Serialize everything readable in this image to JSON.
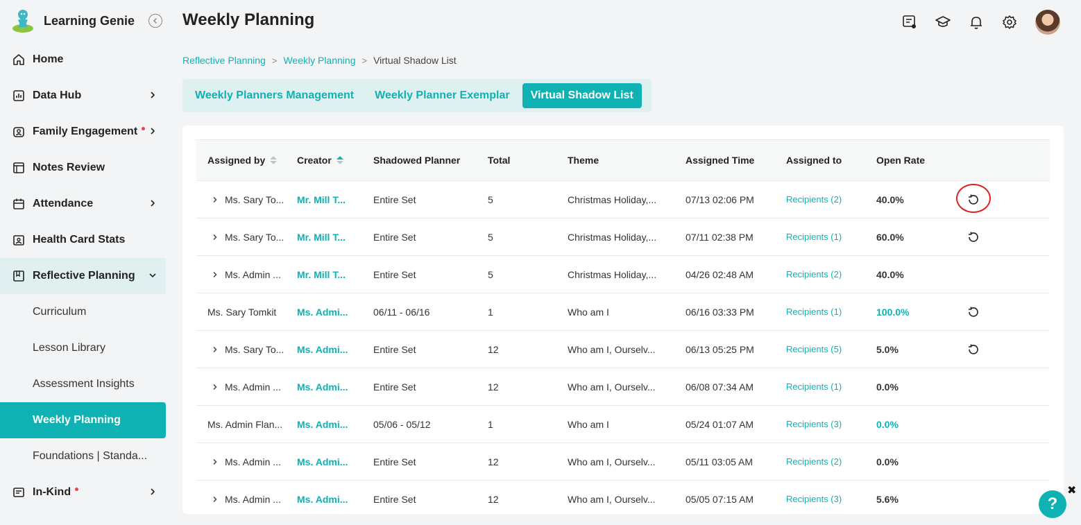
{
  "app": {
    "name": "Learning Genie"
  },
  "nav": {
    "home": "Home",
    "data_hub": "Data Hub",
    "family_engagement": "Family Engagement",
    "notes_review": "Notes Review",
    "attendance": "Attendance",
    "health_card_stats": "Health Card Stats",
    "reflective_planning": "Reflective Planning",
    "sub": {
      "curriculum": "Curriculum",
      "lesson_library": "Lesson Library",
      "assessment_insights": "Assessment Insights",
      "weekly_planning": "Weekly Planning",
      "foundations": "Foundations | Standa..."
    },
    "in_kind": "In-Kind"
  },
  "header": {
    "title": "Weekly Planning"
  },
  "breadcrumb": {
    "items": [
      "Reflective Planning",
      "Weekly Planning",
      "Virtual Shadow List"
    ],
    "separator": ">"
  },
  "tabs": [
    "Weekly Planners Management",
    "Weekly Planner Exemplar",
    "Virtual Shadow List"
  ],
  "table": {
    "columns": [
      "Assigned by",
      "Creator",
      "Shadowed Planner",
      "Total",
      "Theme",
      "Assigned Time",
      "Assigned to",
      "Open Rate"
    ],
    "rows": [
      {
        "assigned_by": "Ms. Sary To...",
        "creator": "Mr. Mill T...",
        "planner": "Entire Set",
        "total": "5",
        "theme": "Christmas Holiday,...",
        "time": "07/13 02:06 PM",
        "assigned_to": "Recipients (2)",
        "rate": "40.0%"
      },
      {
        "assigned_by": "Ms. Sary To...",
        "creator": "Mr. Mill T...",
        "planner": "Entire Set",
        "total": "5",
        "theme": "Christmas Holiday,...",
        "time": "07/11 02:38 PM",
        "assigned_to": "Recipients (1)",
        "rate": "60.0%"
      },
      {
        "assigned_by": "Ms. Admin ...",
        "creator": "Mr. Mill T...",
        "planner": "Entire Set",
        "total": "5",
        "theme": "Christmas Holiday,...",
        "time": "04/26 02:48 AM",
        "assigned_to": "Recipients (2)",
        "rate": "40.0%"
      },
      {
        "assigned_by": "Ms. Sary Tomkit",
        "creator": "Ms. Admi...",
        "planner": "06/11 - 06/16",
        "total": "1",
        "theme": "Who am I",
        "time": "06/16 03:33 PM",
        "assigned_to": "Recipients (1)",
        "rate": "100.0%"
      },
      {
        "assigned_by": "Ms. Sary To...",
        "creator": "Ms. Admi...",
        "planner": "Entire Set",
        "total": "12",
        "theme": "Who am I, Ourselv...",
        "time": "06/13 05:25 PM",
        "assigned_to": "Recipients (5)",
        "rate": "5.0%"
      },
      {
        "assigned_by": "Ms. Admin ...",
        "creator": "Ms. Admi...",
        "planner": "Entire Set",
        "total": "12",
        "theme": "Who am I, Ourselv...",
        "time": "06/08 07:34 AM",
        "assigned_to": "Recipients (1)",
        "rate": "0.0%"
      },
      {
        "assigned_by": "Ms. Admin Flan...",
        "creator": "Ms. Admi...",
        "planner": "05/06 - 05/12",
        "total": "1",
        "theme": "Who am I",
        "time": "05/24 01:07 AM",
        "assigned_to": "Recipients (3)",
        "rate": "0.0%"
      },
      {
        "assigned_by": "Ms. Admin ...",
        "creator": "Ms. Admi...",
        "planner": "Entire Set",
        "total": "12",
        "theme": "Who am I, Ourselv...",
        "time": "05/11 03:05 AM",
        "assigned_to": "Recipients (2)",
        "rate": "0.0%"
      },
      {
        "assigned_by": "Ms. Admin ...",
        "creator": "Ms. Admi...",
        "planner": "Entire Set",
        "total": "12",
        "theme": "Who am I, Ourselv...",
        "time": "05/05 07:15 AM",
        "assigned_to": "Recipients (3)",
        "rate": "5.6%"
      }
    ]
  },
  "help": {
    "label": "?",
    "close": "✖"
  },
  "colors": {
    "accent": "#10b1b3",
    "highlight": "#e02020",
    "badge_dot": "#e24a4a"
  }
}
